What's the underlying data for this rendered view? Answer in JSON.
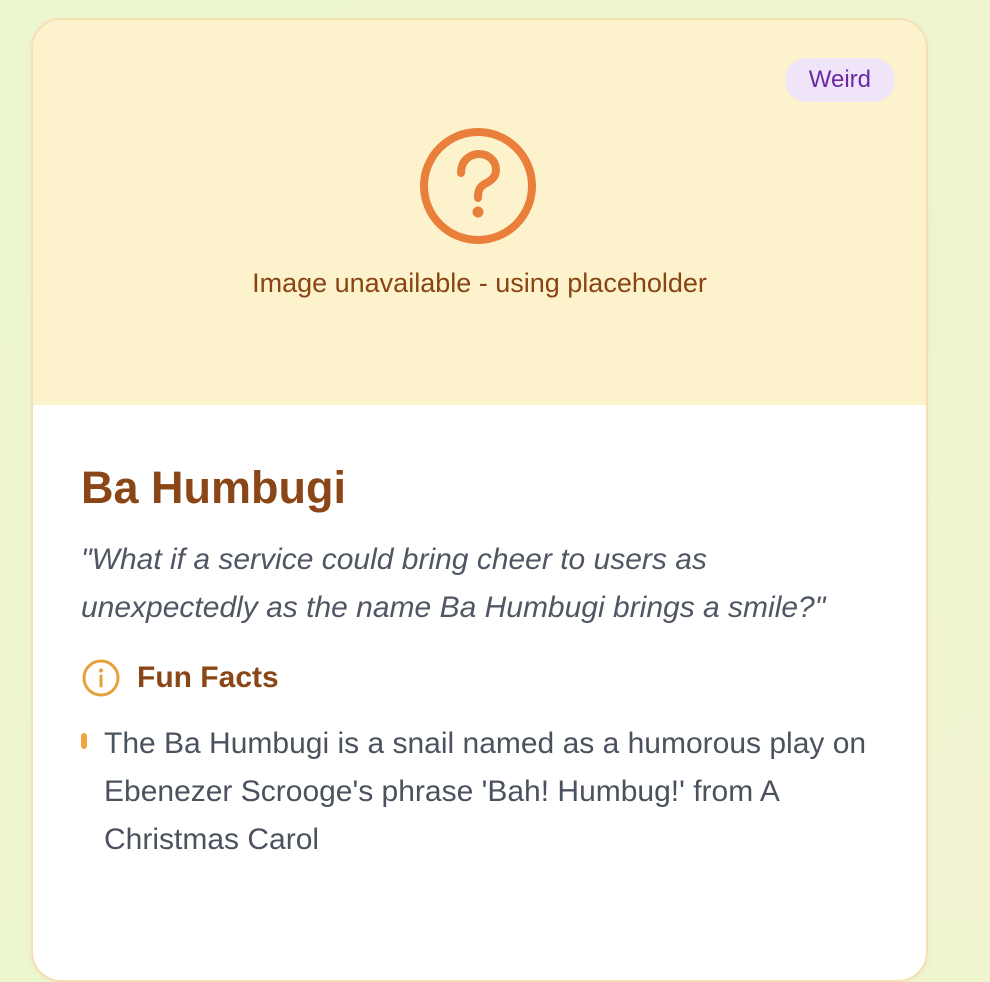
{
  "card": {
    "category_badge": "Weird",
    "placeholder": {
      "icon": "question-circle-icon",
      "text": "Image unavailable - using placeholder"
    },
    "title": "Ba Humbugi",
    "quote": "\"What if a service could bring cheer to users as unexpectedly as the name Ba Humbugi brings a smile?\"",
    "facts": {
      "icon": "info-circle-icon",
      "title": "Fun Facts",
      "items": [
        "The Ba Humbugi is a snail named as a humorous play on Ebenezer Scrooge's phrase 'Bah! Humbug!' from A Christmas Carol"
      ]
    }
  },
  "colors": {
    "page_background": "#ecf6cf",
    "media_background": "#fcf2cb",
    "accent_orange": "#ea7f3b",
    "title_brown": "#8a4616",
    "badge_background": "#efe4f8",
    "badge_text": "#6b2aa5",
    "bullet": "#f0a540"
  }
}
